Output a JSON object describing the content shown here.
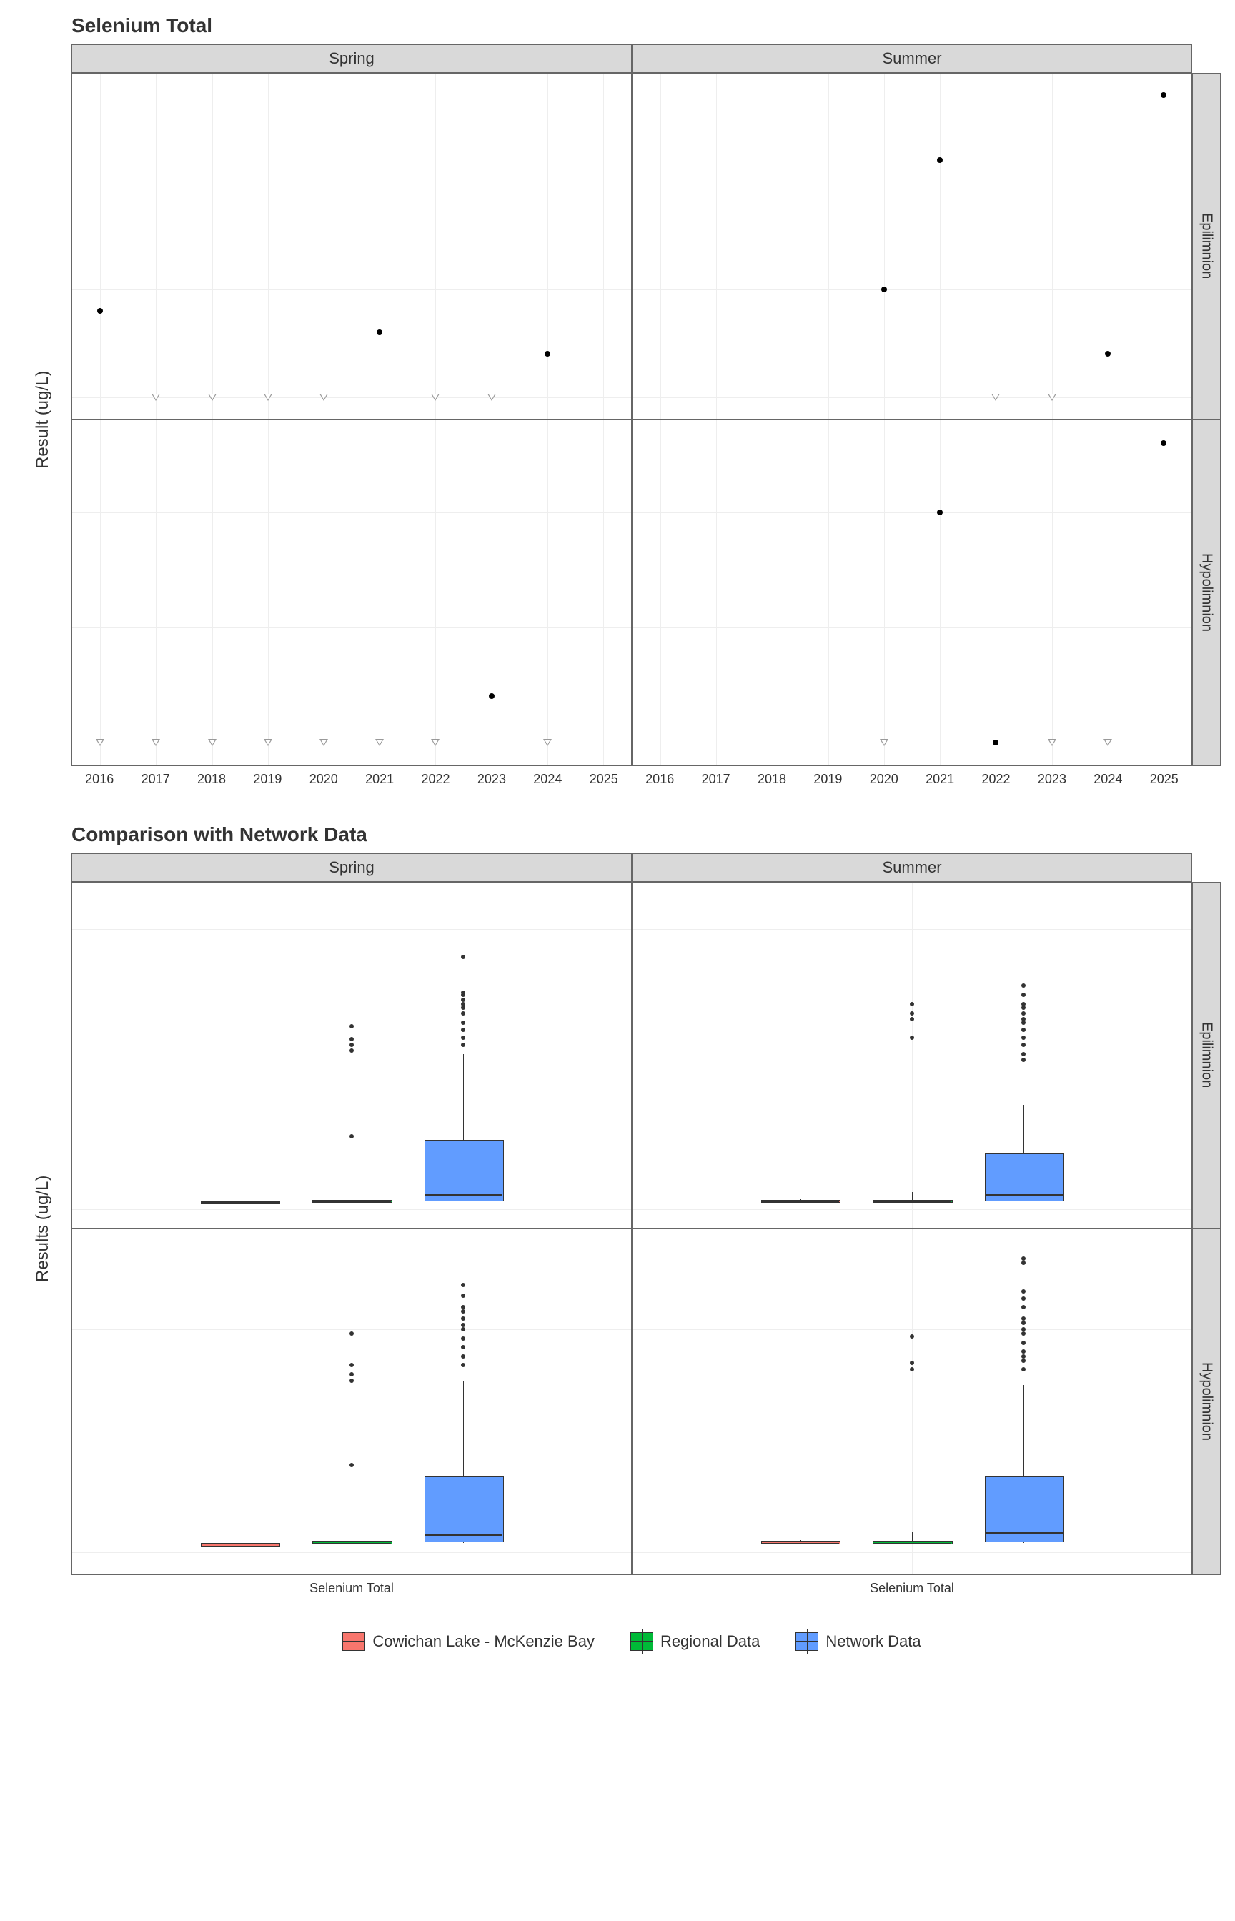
{
  "chart_data": [
    {
      "type": "scatter",
      "title": "Selenium Total",
      "ylabel": "Result (ug/L)",
      "facet_cols": [
        "Spring",
        "Summer"
      ],
      "facet_rows": [
        "Epilimnion",
        "Hypolimnion"
      ],
      "x_ticks": [
        2016,
        2017,
        2018,
        2019,
        2020,
        2021,
        2022,
        2023,
        2024,
        2025
      ],
      "y_ticks_top": [
        0.04,
        0.045,
        0.05
      ],
      "y_ticks_bottom": [
        0.04,
        0.045,
        0.05
      ],
      "xlim": [
        2015.5,
        2025.5
      ],
      "ylim_top": [
        0.039,
        0.055
      ],
      "ylim_bottom": [
        0.039,
        0.054
      ],
      "panels": {
        "Spring_Epilimnion": {
          "points": [
            {
              "x": 2016,
              "y": 0.044
            },
            {
              "x": 2021,
              "y": 0.043
            },
            {
              "x": 2024,
              "y": 0.042
            }
          ],
          "censored": [
            {
              "x": 2017,
              "y": 0.04
            },
            {
              "x": 2018,
              "y": 0.04
            },
            {
              "x": 2019,
              "y": 0.04
            },
            {
              "x": 2020,
              "y": 0.04
            },
            {
              "x": 2022,
              "y": 0.04
            },
            {
              "x": 2023,
              "y": 0.04
            }
          ]
        },
        "Summer_Epilimnion": {
          "points": [
            {
              "x": 2020,
              "y": 0.045
            },
            {
              "x": 2021,
              "y": 0.051
            },
            {
              "x": 2024,
              "y": 0.042
            },
            {
              "x": 2025,
              "y": 0.054
            }
          ],
          "censored": [
            {
              "x": 2022,
              "y": 0.04
            },
            {
              "x": 2023,
              "y": 0.04
            }
          ]
        },
        "Spring_Hypolimnion": {
          "points": [
            {
              "x": 2023,
              "y": 0.042
            }
          ],
          "censored": [
            {
              "x": 2016,
              "y": 0.04
            },
            {
              "x": 2017,
              "y": 0.04
            },
            {
              "x": 2018,
              "y": 0.04
            },
            {
              "x": 2019,
              "y": 0.04
            },
            {
              "x": 2020,
              "y": 0.04
            },
            {
              "x": 2021,
              "y": 0.04
            },
            {
              "x": 2022,
              "y": 0.04
            },
            {
              "x": 2024,
              "y": 0.04
            }
          ]
        },
        "Summer_Hypolimnion": {
          "points": [
            {
              "x": 2021,
              "y": 0.05
            },
            {
              "x": 2022,
              "y": 0.04
            },
            {
              "x": 2025,
              "y": 0.053
            }
          ],
          "censored": [
            {
              "x": 2020,
              "y": 0.04
            },
            {
              "x": 2023,
              "y": 0.04
            },
            {
              "x": 2024,
              "y": 0.04
            }
          ]
        }
      }
    },
    {
      "type": "boxplot",
      "title": "Comparison with Network Data",
      "ylabel": "Results (ug/L)",
      "xlabel": "Selenium Total",
      "facet_cols": [
        "Spring",
        "Summer"
      ],
      "facet_rows": [
        "Epilimnion",
        "Hypolimnion"
      ],
      "y_ticks_top": [
        0.0,
        0.5,
        1.0,
        1.5
      ],
      "y_ticks_bottom": [
        0.0,
        0.5,
        1.0
      ],
      "ylim_top": [
        -0.1,
        1.75
      ],
      "ylim_bottom": [
        -0.1,
        1.45
      ],
      "series_names": [
        "Cowichan Lake - McKenzie Bay",
        "Regional Data",
        "Network Data"
      ],
      "panels": {
        "Spring_Epilimnion": {
          "ylim": [
            -0.1,
            1.75
          ],
          "boxes": [
            {
              "group": "Cowichan Lake - McKenzie Bay",
              "q1": 0.04,
              "median": 0.04,
              "q3": 0.044,
              "low": 0.04,
              "high": 0.044,
              "outliers": []
            },
            {
              "group": "Regional Data",
              "q1": 0.04,
              "median": 0.04,
              "q3": 0.05,
              "low": 0.04,
              "high": 0.07,
              "outliers": [
                0.39,
                0.85,
                0.88,
                0.91,
                0.98
              ]
            },
            {
              "group": "Network Data",
              "q1": 0.05,
              "median": 0.08,
              "q3": 0.37,
              "low": 0.04,
              "high": 0.83,
              "outliers": [
                0.88,
                0.92,
                0.96,
                1.0,
                1.05,
                1.08,
                1.1,
                1.12,
                1.15,
                1.16,
                1.35
              ]
            }
          ]
        },
        "Summer_Epilimnion": {
          "ylim": [
            -0.1,
            1.75
          ],
          "boxes": [
            {
              "group": "Cowichan Lake - McKenzie Bay",
              "q1": 0.04,
              "median": 0.044,
              "q3": 0.05,
              "low": 0.04,
              "high": 0.054,
              "outliers": []
            },
            {
              "group": "Regional Data",
              "q1": 0.04,
              "median": 0.04,
              "q3": 0.05,
              "low": 0.04,
              "high": 0.09,
              "outliers": [
                0.92,
                1.02,
                1.05,
                1.1
              ]
            },
            {
              "group": "Network Data",
              "q1": 0.05,
              "median": 0.08,
              "q3": 0.3,
              "low": 0.04,
              "high": 0.56,
              "outliers": [
                0.8,
                0.83,
                0.88,
                0.92,
                0.96,
                1.0,
                1.02,
                1.05,
                1.08,
                1.1,
                1.15,
                1.2
              ]
            }
          ]
        },
        "Spring_Hypolimnion": {
          "ylim": [
            -0.1,
            1.45
          ],
          "boxes": [
            {
              "group": "Cowichan Lake - McKenzie Bay",
              "q1": 0.04,
              "median": 0.04,
              "q3": 0.04,
              "low": 0.04,
              "high": 0.042,
              "outliers": []
            },
            {
              "group": "Regional Data",
              "q1": 0.04,
              "median": 0.04,
              "q3": 0.05,
              "low": 0.04,
              "high": 0.06,
              "outliers": [
                0.39,
                0.77,
                0.8,
                0.84,
                0.98
              ]
            },
            {
              "group": "Network Data",
              "q1": 0.05,
              "median": 0.08,
              "q3": 0.34,
              "low": 0.04,
              "high": 0.77,
              "outliers": [
                0.84,
                0.88,
                0.92,
                0.96,
                1.0,
                1.02,
                1.05,
                1.08,
                1.1,
                1.15,
                1.2
              ]
            }
          ]
        },
        "Summer_Hypolimnion": {
          "ylim": [
            -0.1,
            1.45
          ],
          "boxes": [
            {
              "group": "Cowichan Lake - McKenzie Bay",
              "q1": 0.04,
              "median": 0.04,
              "q3": 0.05,
              "low": 0.04,
              "high": 0.053,
              "outliers": []
            },
            {
              "group": "Regional Data",
              "q1": 0.04,
              "median": 0.04,
              "q3": 0.05,
              "low": 0.04,
              "high": 0.09,
              "outliers": [
                0.82,
                0.85,
                0.97
              ]
            },
            {
              "group": "Network Data",
              "q1": 0.05,
              "median": 0.09,
              "q3": 0.34,
              "low": 0.04,
              "high": 0.75,
              "outliers": [
                0.82,
                0.86,
                0.88,
                0.9,
                0.94,
                0.98,
                1.0,
                1.03,
                1.05,
                1.1,
                1.14,
                1.17,
                1.3,
                1.32
              ]
            }
          ]
        }
      }
    }
  ],
  "legend": {
    "items": [
      "Cowichan Lake - McKenzie Bay",
      "Regional Data",
      "Network Data"
    ]
  }
}
